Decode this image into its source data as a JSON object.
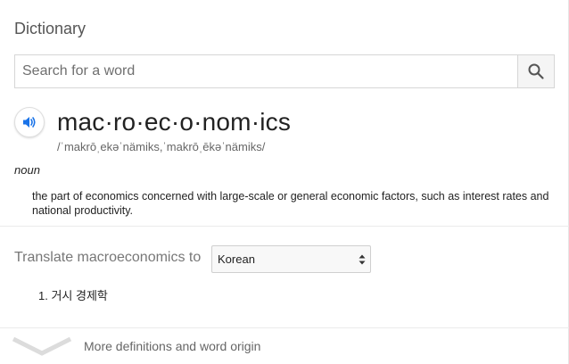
{
  "header": {
    "title": "Dictionary"
  },
  "search": {
    "placeholder": "Search for a word",
    "value": ""
  },
  "entry": {
    "headword": "mac·ro·ec·o·nom·ics",
    "pronunciation": "/ˈmakrōˌekəˈnämiks,ˈmakrōˌēkəˈnämiks/",
    "part_of_speech": "noun",
    "definition": "the part of economics concerned with large-scale or general economic factors, such as interest rates and national productivity."
  },
  "translate": {
    "label": "Translate macroeconomics to",
    "selected_language": "Korean",
    "results": [
      "1. 거시 경제학"
    ]
  },
  "footer": {
    "more_label": "More definitions and word origin"
  },
  "icons": {
    "search": "search-icon",
    "speaker": "speaker-icon",
    "select_arrows": "updown-arrows-icon",
    "expand": "chevron-down-icon"
  },
  "colors": {
    "speaker_blue": "#1a73e8",
    "text_muted": "#777777",
    "border": "#d6d6d6"
  }
}
